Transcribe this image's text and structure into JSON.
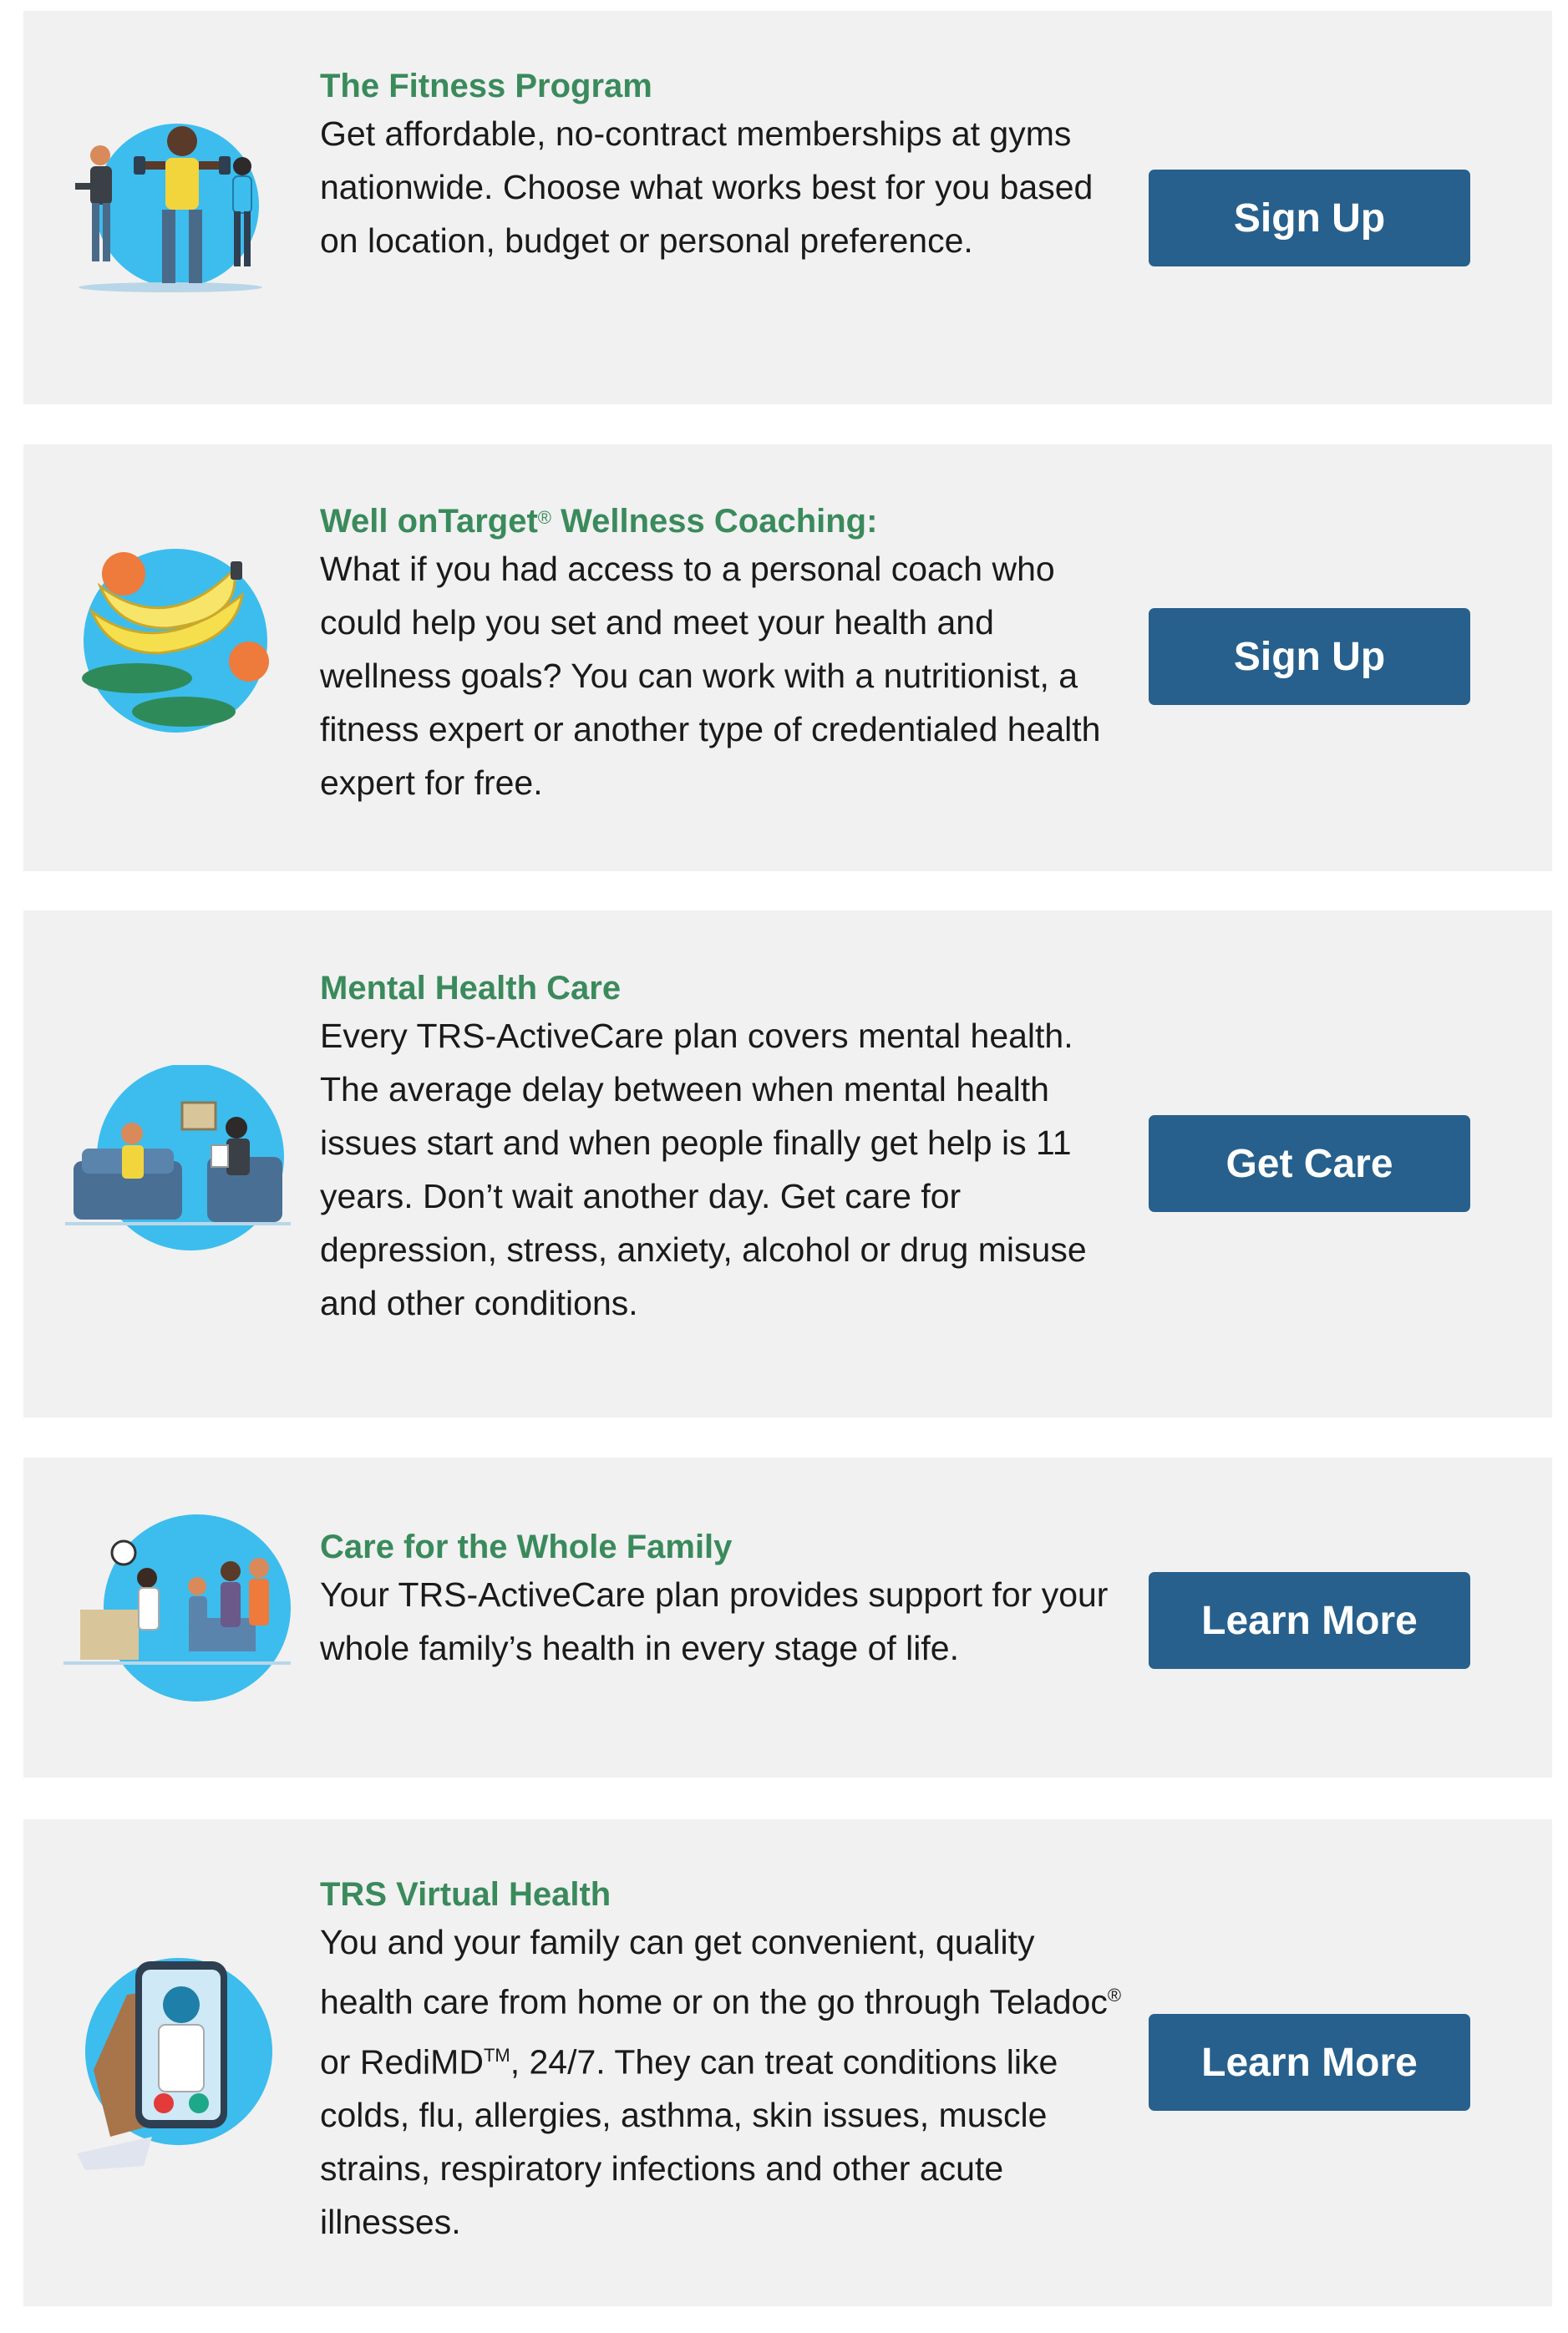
{
  "cards": [
    {
      "icon": "fitness-people-icon",
      "title": "The Fitness Program",
      "description": "Get affordable, no-contract memberships at gyms nationwide. Choose what works best for you based on location, budget or personal preference.",
      "button_label": "Sign Up"
    },
    {
      "icon": "healthy-food-icon",
      "title_main": "Well onTarget",
      "title_mark": "®",
      "title_rest": " Wellness Coaching:",
      "description": "What if you had access to a personal coach who could help you set and meet your health and wellness goals? You can work with a nutritionist, a fitness expert or another type of credentialed health expert for free.",
      "button_label": "Sign Up"
    },
    {
      "icon": "therapy-session-icon",
      "title": "Mental Health Care",
      "description": "Every TRS-ActiveCare plan covers mental health. The average delay between when mental health issues start and when people finally get help is 11 years. Don’t wait another day. Get care for depression, stress, anxiety, alcohol or drug misuse and other conditions.",
      "button_label": "Get Care"
    },
    {
      "icon": "family-doctor-visit-icon",
      "title": "Care for the Whole Family",
      "description": "Your TRS-ActiveCare plan provides support for your whole family’s health in every stage of life.",
      "button_label": "Learn More"
    },
    {
      "icon": "phone-video-call-doctor-icon",
      "title": "TRS Virtual Health",
      "description_a": "You and your family can get convenient, quality health care from home or on the go through Teladoc",
      "description_reg": "®",
      "description_b": " or RediMD",
      "description_tm": "TM",
      "description_c": ", 24/7. They can treat conditions like colds, flu, allergies, asthma, skin issues, muscle strains, respiratory infections and other acute illnesses.",
      "button_label": "Learn More"
    }
  ],
  "colors": {
    "title_green": "#3a8a5c",
    "button_blue": "#27608c",
    "card_bg": "#f1f1f1",
    "icon_circle": "#3cbdee"
  }
}
